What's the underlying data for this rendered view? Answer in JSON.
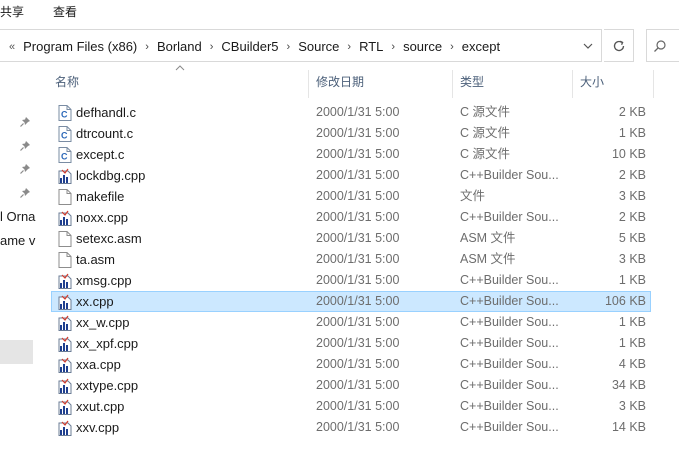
{
  "ribbon": {
    "tabs": [
      "共享",
      "查看"
    ]
  },
  "address": {
    "lead": "«",
    "crumbs": [
      "Program Files (x86)",
      "Borland",
      "CBuilder5",
      "Source",
      "RTL",
      "source",
      "except"
    ]
  },
  "nav": {
    "items": [
      "l Orna",
      "ame v"
    ]
  },
  "columns": {
    "name": "名称",
    "date": "修改日期",
    "type": "类型",
    "size": "大小"
  },
  "files": [
    {
      "name": "defhandl.c",
      "date": "2000/1/31 5:00",
      "type": "C 源文件",
      "size": "2 KB",
      "icon": "c-source-icon"
    },
    {
      "name": "dtrcount.c",
      "date": "2000/1/31 5:00",
      "type": "C 源文件",
      "size": "1 KB",
      "icon": "c-source-icon"
    },
    {
      "name": "except.c",
      "date": "2000/1/31 5:00",
      "type": "C 源文件",
      "size": "10 KB",
      "icon": "c-source-icon"
    },
    {
      "name": "lockdbg.cpp",
      "date": "2000/1/31 5:00",
      "type": "C++Builder Sou...",
      "size": "2 KB",
      "icon": "cpp-builder-icon"
    },
    {
      "name": "makefile",
      "date": "2000/1/31 5:00",
      "type": "文件",
      "size": "3 KB",
      "icon": "blank-file-icon"
    },
    {
      "name": "noxx.cpp",
      "date": "2000/1/31 5:00",
      "type": "C++Builder Sou...",
      "size": "2 KB",
      "icon": "cpp-builder-icon"
    },
    {
      "name": "setexc.asm",
      "date": "2000/1/31 5:00",
      "type": "ASM 文件",
      "size": "5 KB",
      "icon": "blank-file-icon"
    },
    {
      "name": "ta.asm",
      "date": "2000/1/31 5:00",
      "type": "ASM 文件",
      "size": "3 KB",
      "icon": "blank-file-icon"
    },
    {
      "name": "xmsg.cpp",
      "date": "2000/1/31 5:00",
      "type": "C++Builder Sou...",
      "size": "1 KB",
      "icon": "cpp-builder-icon"
    },
    {
      "name": "xx.cpp",
      "date": "2000/1/31 5:00",
      "type": "C++Builder Sou...",
      "size": "106 KB",
      "icon": "cpp-builder-icon",
      "selected": true
    },
    {
      "name": "xx_w.cpp",
      "date": "2000/1/31 5:00",
      "type": "C++Builder Sou...",
      "size": "1 KB",
      "icon": "cpp-builder-icon"
    },
    {
      "name": "xx_xpf.cpp",
      "date": "2000/1/31 5:00",
      "type": "C++Builder Sou...",
      "size": "1 KB",
      "icon": "cpp-builder-icon"
    },
    {
      "name": "xxa.cpp",
      "date": "2000/1/31 5:00",
      "type": "C++Builder Sou...",
      "size": "4 KB",
      "icon": "cpp-builder-icon"
    },
    {
      "name": "xxtype.cpp",
      "date": "2000/1/31 5:00",
      "type": "C++Builder Sou...",
      "size": "34 KB",
      "icon": "cpp-builder-icon"
    },
    {
      "name": "xxut.cpp",
      "date": "2000/1/31 5:00",
      "type": "C++Builder Sou...",
      "size": "3 KB",
      "icon": "cpp-builder-icon"
    },
    {
      "name": "xxv.cpp",
      "date": "2000/1/31 5:00",
      "type": "C++Builder Sou...",
      "size": "14 KB",
      "icon": "cpp-builder-icon"
    }
  ],
  "colors": {
    "selected_bg": "#cce8ff",
    "selected_border": "#99d1ff",
    "header_text": "#4c607a",
    "meta_text": "#6d6d6d"
  }
}
